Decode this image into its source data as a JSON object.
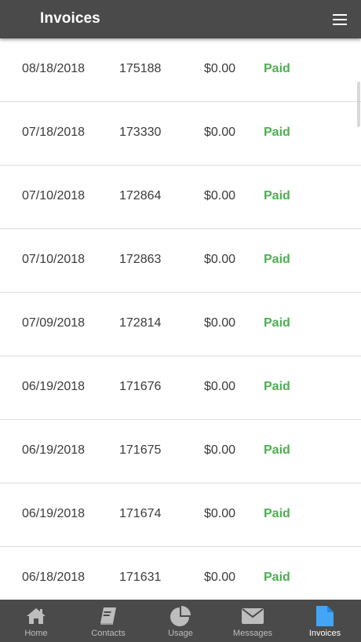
{
  "header": {
    "title": "Invoices",
    "menu_icon": "hamburger-menu-icon"
  },
  "invoices": [
    {
      "date": "08/18/2018",
      "number": "175188",
      "amount": "$0.00",
      "status": "Paid"
    },
    {
      "date": "07/18/2018",
      "number": "173330",
      "amount": "$0.00",
      "status": "Paid"
    },
    {
      "date": "07/10/2018",
      "number": "172864",
      "amount": "$0.00",
      "status": "Paid"
    },
    {
      "date": "07/10/2018",
      "number": "172863",
      "amount": "$0.00",
      "status": "Paid"
    },
    {
      "date": "07/09/2018",
      "number": "172814",
      "amount": "$0.00",
      "status": "Paid"
    },
    {
      "date": "06/19/2018",
      "number": "171676",
      "amount": "$0.00",
      "status": "Paid"
    },
    {
      "date": "06/19/2018",
      "number": "171675",
      "amount": "$0.00",
      "status": "Paid"
    },
    {
      "date": "06/19/2018",
      "number": "171674",
      "amount": "$0.00",
      "status": "Paid"
    },
    {
      "date": "06/18/2018",
      "number": "171631",
      "amount": "$0.00",
      "status": "Paid"
    }
  ],
  "tabbar": {
    "items": [
      {
        "label": "Home",
        "icon": "home-icon",
        "active": false
      },
      {
        "label": "Contacts",
        "icon": "contacts-book-icon",
        "active": false
      },
      {
        "label": "Usage",
        "icon": "pie-chart-icon",
        "active": false
      },
      {
        "label": "Messages",
        "icon": "envelope-icon",
        "active": false
      },
      {
        "label": "Invoices",
        "icon": "document-icon",
        "active": true
      }
    ]
  },
  "colors": {
    "header_bg": "#4a4a4a",
    "paid_green": "#4caf50",
    "active_tab_icon": "#42a5f5",
    "inactive_tab_icon": "#bdbdbd"
  }
}
